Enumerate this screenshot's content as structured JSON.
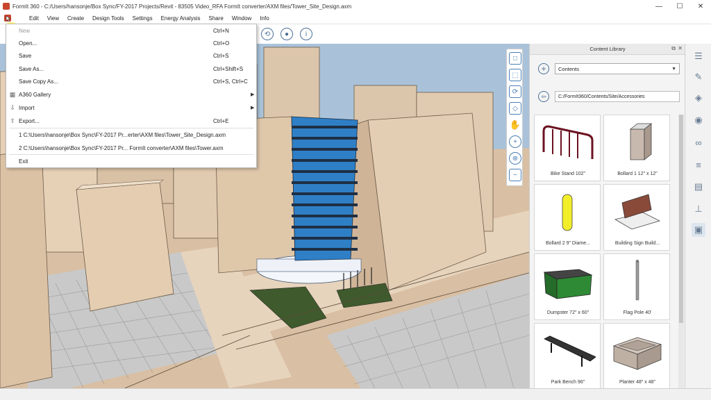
{
  "window": {
    "title": "FormIt 360 - C:/Users/hansonje/Box Sync/FY-2017 Projects/Revit - 83505 Video_RFA FormIt converter/AXM files/Tower_Site_Design.axm",
    "minimize": "—",
    "maximize": "☐",
    "close": "✕"
  },
  "menubar": {
    "items": [
      "Edit",
      "View",
      "Create",
      "Design Tools",
      "Settings",
      "Energy Analysis",
      "Share",
      "Window",
      "Info"
    ]
  },
  "file_menu": {
    "items": [
      {
        "label": "New",
        "shortcut": "Ctrl+N",
        "disabled": true
      },
      {
        "label": "Open...",
        "shortcut": "Ctrl+O"
      },
      {
        "label": "Save",
        "shortcut": "Ctrl+S"
      },
      {
        "label": "Save As...",
        "shortcut": "Ctrl+Shift+S"
      },
      {
        "label": "Save Copy As...",
        "shortcut": "Ctrl+S, Ctrl+C"
      },
      {
        "label": "A360 Gallery",
        "shortcut": "",
        "submenu": true
      },
      {
        "label": "Import",
        "shortcut": "",
        "submenu": true
      },
      {
        "label": "Export...",
        "shortcut": "Ctrl+E"
      },
      {
        "label": "1 C:\\Users\\hansonje\\Box Sync\\FY-2017 Pr...erter\\AXM files\\Tower_Site_Design.axm",
        "shortcut": ""
      },
      {
        "label": "2 C:\\Users\\hansonje\\Box Sync\\FY-2017 Pr... FormIt converter\\AXM files\\Tower.axm",
        "shortcut": ""
      },
      {
        "label": "Exit",
        "shortcut": ""
      }
    ]
  },
  "library": {
    "title": "Content Library",
    "dropdown_value": "Contents",
    "path": "C:/FormIt360/Contents/Site/Accessories",
    "items": [
      {
        "name": "Bike Stand 102\""
      },
      {
        "name": "Bollard 1 12\" x 12\""
      },
      {
        "name": "Bollard 2 9\" Diame..."
      },
      {
        "name": "Building Sign Build..."
      },
      {
        "name": "Dumpster 72\" x 60\""
      },
      {
        "name": "Flag Pole 40'"
      },
      {
        "name": "Park Bench 96\""
      },
      {
        "name": "Planter 48\" x 48\""
      }
    ]
  },
  "colors": {
    "accent": "#4a6f97",
    "building": "#e3cdb2",
    "tower_glass": "#2f7fc6"
  }
}
